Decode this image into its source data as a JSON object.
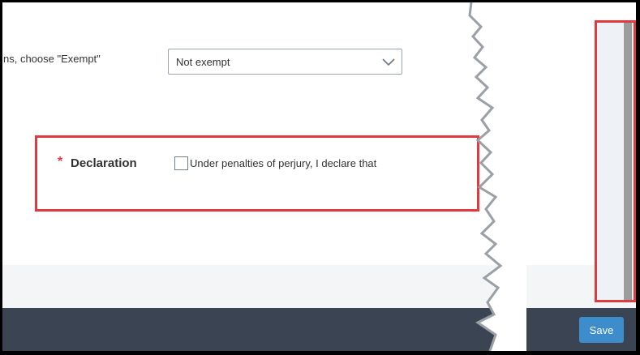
{
  "form": {
    "exempt_label": "ns, choose \"Exempt\"",
    "exempt_select": {
      "value": "Not exempt"
    },
    "declaration": {
      "required_marker": "*",
      "label": "Declaration",
      "checked": false,
      "text": "Under penalties of perjury, I declare that"
    }
  },
  "footer": {
    "save_label": "Save"
  },
  "colors": {
    "highlight": "#e0393e",
    "footer_bar": "#3b4452",
    "save_button": "#3d8dcc"
  },
  "icons": {
    "select_arrow": "chevron-down-icon"
  }
}
